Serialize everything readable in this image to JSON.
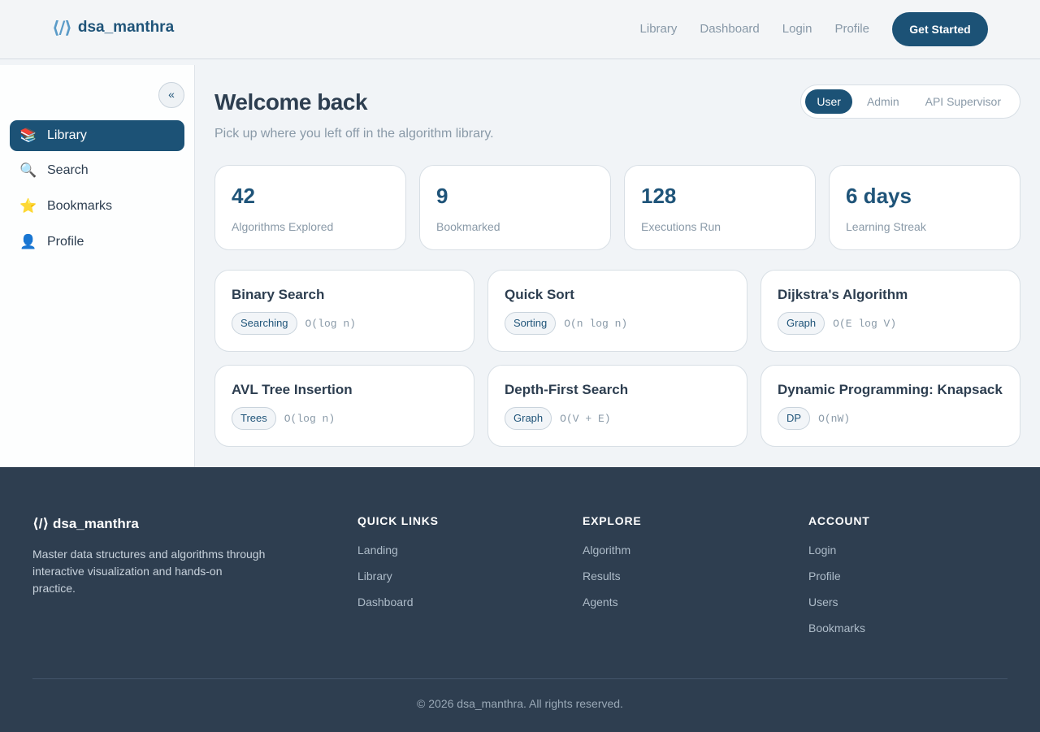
{
  "header": {
    "brand_icon": "⟨/⟩",
    "brand_name": "dsa_manthra",
    "nav": [
      "Library",
      "Dashboard",
      "Login",
      "Profile"
    ],
    "cta": "Get Started"
  },
  "sidebar": {
    "collapse_label": "«",
    "items": [
      {
        "icon": "📚",
        "label": "Library",
        "active": true
      },
      {
        "icon": "🔍",
        "label": "Search",
        "active": false
      },
      {
        "icon": "⭐",
        "label": "Bookmarks",
        "active": false
      },
      {
        "icon": "👤",
        "label": "Profile",
        "active": false
      }
    ]
  },
  "main": {
    "title": "Welcome back",
    "subtitle": "Pick up where you left off in the algorithm library.",
    "roles": [
      "User",
      "Admin",
      "API Supervisor"
    ],
    "active_role": "User",
    "stats": [
      {
        "value": "42",
        "label": "Algorithms Explored"
      },
      {
        "value": "9",
        "label": "Bookmarked"
      },
      {
        "value": "128",
        "label": "Executions Run"
      },
      {
        "value": "6 days",
        "label": "Learning Streak"
      }
    ],
    "algorithms": [
      {
        "name": "Binary Search",
        "tag": "Searching",
        "complexity": "O(log n)"
      },
      {
        "name": "Quick Sort",
        "tag": "Sorting",
        "complexity": "O(n log n)"
      },
      {
        "name": "Dijkstra's Algorithm",
        "tag": "Graph",
        "complexity": "O(E log V)"
      },
      {
        "name": "AVL Tree Insertion",
        "tag": "Trees",
        "complexity": "O(log n)"
      },
      {
        "name": "Depth-First Search",
        "tag": "Graph",
        "complexity": "O(V + E)"
      },
      {
        "name": "Dynamic Programming: Knapsack",
        "tag": "DP",
        "complexity": "O(nW)"
      }
    ]
  },
  "footer": {
    "brand": "⟨/⟩ dsa_manthra",
    "description": "Master data structures and algorithms through interactive visualization and hands-on practice.",
    "columns": [
      {
        "heading": "QUICK LINKS",
        "links": [
          "Landing",
          "Library",
          "Dashboard"
        ]
      },
      {
        "heading": "EXPLORE",
        "links": [
          "Algorithm",
          "Results",
          "Agents"
        ]
      },
      {
        "heading": "ACCOUNT",
        "links": [
          "Login",
          "Profile",
          "Users",
          "Bookmarks"
        ]
      }
    ],
    "copyright": "© 2026 dsa_manthra. All rights reserved."
  },
  "colors": {
    "primary": "#1c5276",
    "footer_bg": "#2e3e50",
    "muted_text": "#8a9aa8"
  }
}
